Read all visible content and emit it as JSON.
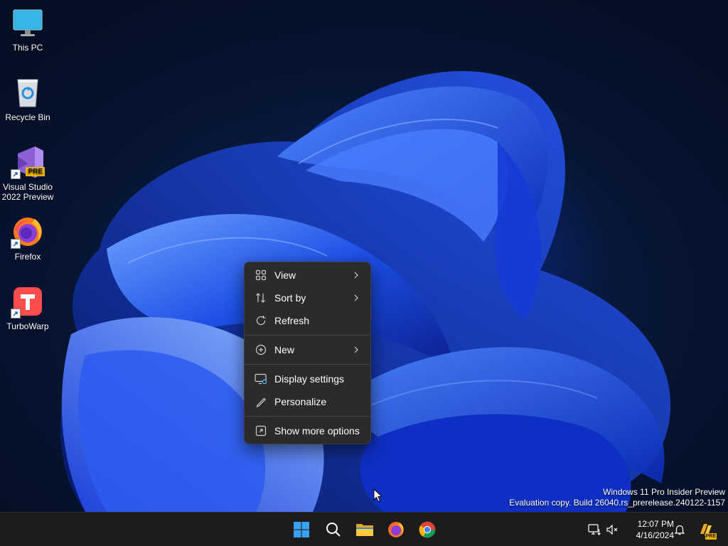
{
  "desktop_icons": [
    {
      "label": "This PC",
      "icon": "monitor-icon"
    },
    {
      "label": "Recycle Bin",
      "icon": "recycle-bin-icon"
    },
    {
      "label_line1": "Visual Studio",
      "label_line2": "2022 Preview",
      "icon": "visual-studio-icon",
      "badge": "PRE"
    },
    {
      "label": "Firefox",
      "icon": "firefox-icon"
    },
    {
      "label": "TurboWarp",
      "icon": "turbowarp-icon"
    }
  ],
  "context_menu": {
    "items": [
      {
        "label": "View",
        "icon": "grid-view-icon",
        "submenu": true
      },
      {
        "label": "Sort by",
        "icon": "sort-icon",
        "submenu": true
      },
      {
        "label": "Refresh",
        "icon": "refresh-icon",
        "submenu": false
      },
      {
        "label": "New",
        "icon": "plus-circle-icon",
        "submenu": true
      },
      {
        "label": "Display settings",
        "icon": "display-settings-icon",
        "submenu": false
      },
      {
        "label": "Personalize",
        "icon": "pen-icon",
        "submenu": false
      },
      {
        "label": "Show more options",
        "icon": "expand-icon",
        "submenu": false
      }
    ]
  },
  "watermark": {
    "line1": "Windows 11 Pro Insider Preview",
    "line2": "Evaluation copy. Build 26040.rs_prerelease.240122-1157"
  },
  "taskbar": {
    "apps": [
      "start-icon",
      "search-icon",
      "file-explorer-icon",
      "firefox-icon",
      "chrome-icon"
    ],
    "tray": [
      "network-icon",
      "volume-muted-icon"
    ],
    "time": "12:07 PM",
    "date": "4/16/2024",
    "copilot_badge": "PRE"
  },
  "colors": {
    "accent": "#0078d4",
    "menu_bg": "#2b2b2b",
    "taskbar_bg": "#1c1c1c"
  }
}
